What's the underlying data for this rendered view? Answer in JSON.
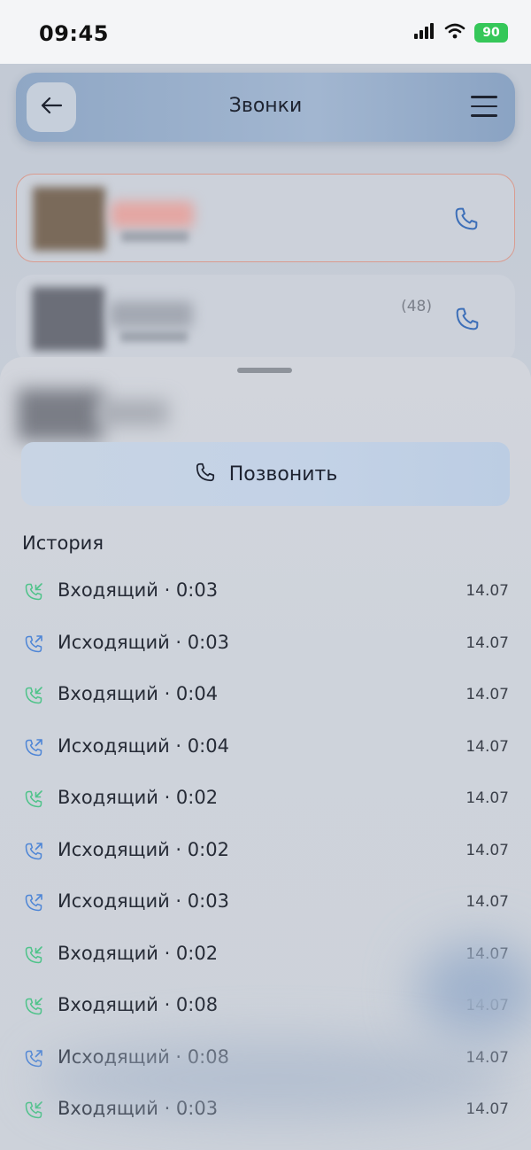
{
  "status_bar": {
    "time": "09:45",
    "battery": "90"
  },
  "header": {
    "title": "Звонки"
  },
  "contacts": [
    {
      "count": ""
    },
    {
      "count": "(48)"
    }
  ],
  "sheet": {
    "call_button_label": "Позвонить",
    "history_title": "История",
    "history": [
      {
        "type": "incoming",
        "label": "Входящий · 0:03",
        "date": "14.07"
      },
      {
        "type": "outgoing",
        "label": "Исходящий · 0:03",
        "date": "14.07"
      },
      {
        "type": "incoming",
        "label": "Входящий · 0:04",
        "date": "14.07"
      },
      {
        "type": "outgoing",
        "label": "Исходящий · 0:04",
        "date": "14.07"
      },
      {
        "type": "incoming",
        "label": "Входящий · 0:02",
        "date": "14.07"
      },
      {
        "type": "outgoing",
        "label": "Исходящий · 0:02",
        "date": "14.07"
      },
      {
        "type": "outgoing",
        "label": "Исходящий · 0:03",
        "date": "14.07"
      },
      {
        "type": "incoming",
        "label": "Входящий · 0:02",
        "date": "14.07"
      },
      {
        "type": "incoming",
        "label": "Входящий · 0:08",
        "date": "14.07"
      },
      {
        "type": "outgoing",
        "label": "Исходящий · 0:08",
        "date": "14.07"
      },
      {
        "type": "incoming",
        "label": "Входящий · 0:03",
        "date": "14.07"
      }
    ]
  },
  "colors": {
    "incoming_icon": "#4fc38a",
    "outgoing_icon": "#4f86d6",
    "accent": "#3d6fb8"
  }
}
